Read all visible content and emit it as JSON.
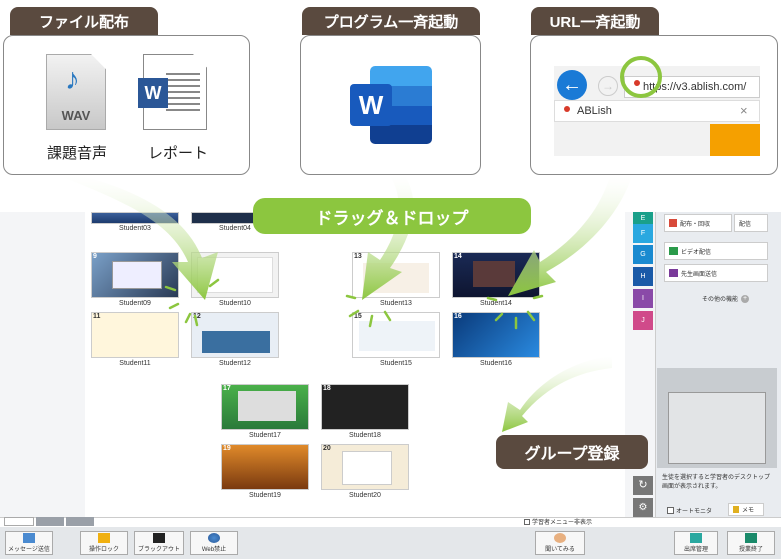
{
  "labels": {
    "file": "ファイル配布",
    "program": "プログラム一斉起動",
    "url": "URL一斉起動",
    "drag": "ドラッグ＆ドロップ",
    "group": "グループ登録"
  },
  "files": {
    "wav_ext": "WAV",
    "item1": "課題音声",
    "item2": "レポート"
  },
  "browser": {
    "url": "https://v3.ablish.com/",
    "suggest": "ABLish",
    "close": "×"
  },
  "students": [
    "Student03",
    "Student04",
    "Student09",
    "Student10",
    "Student11",
    "Student12",
    "Student13",
    "Student14",
    "Student15",
    "Student16",
    "Student17",
    "Student18",
    "Student19",
    "Student20"
  ],
  "numbers": [
    "9",
    "11",
    "12",
    "13",
    "14",
    "15",
    "16",
    "17",
    "18",
    "19",
    "20"
  ],
  "groups": [
    "E",
    "F",
    "G",
    "H",
    "I",
    "J"
  ],
  "panel": {
    "distribute": "配布・回収",
    "memo_top": "配信",
    "video": "ビデオ配信",
    "teacher_screen": "先生画面送信",
    "other": "その他の機能",
    "hint": "生徒を選択すると学習者のデスクトップ画面が表示されます。",
    "auto_monitor": "オートモニタ",
    "memo": "メモ"
  },
  "status": {
    "hide_menu": "学習者メニュー非表示"
  },
  "bottom": {
    "message": "メッセージ送信",
    "lock": "操作ロック",
    "blackout": "ブラックアウト",
    "web": "Web禁止",
    "hand": "聞いてみる",
    "attendance": "出席管理",
    "class_end": "授業終了"
  },
  "colors": {
    "label_bg": "#5a4a3f",
    "arrow_green": "#8cc63f",
    "word_blue": "#2b5797",
    "orange": "#f5a000"
  }
}
